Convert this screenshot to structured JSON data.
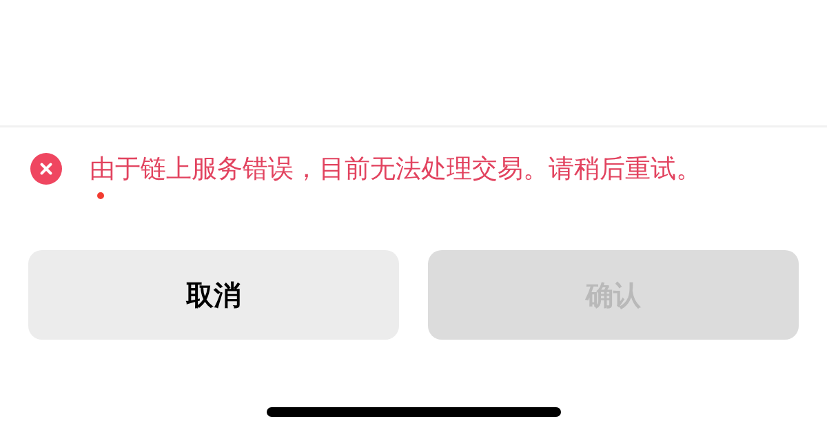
{
  "error": {
    "message": "由于链上服务错误，目前无法处理交易。请稍后重试。"
  },
  "buttons": [
    {
      "label": "取消",
      "disabled": false
    },
    {
      "label": "确认",
      "disabled": true
    }
  ]
}
